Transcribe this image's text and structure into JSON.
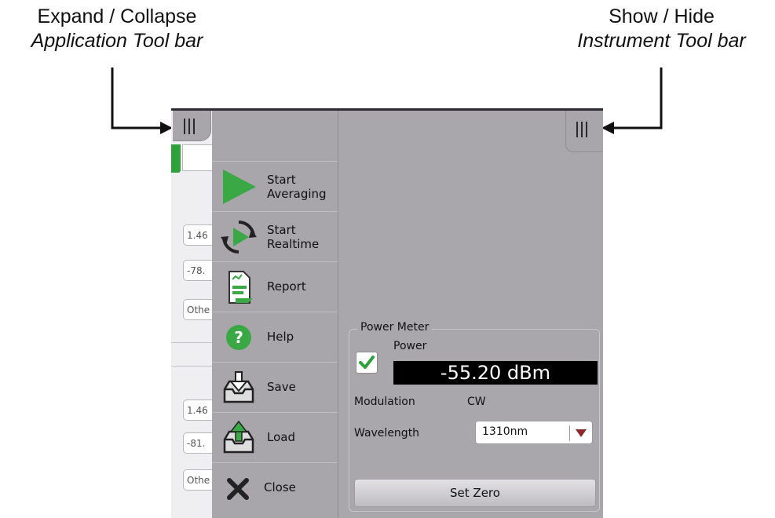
{
  "callouts": {
    "left": {
      "line1": "Expand / Collapse",
      "line2": "Application Tool bar"
    },
    "right": {
      "line1": "Show / Hide",
      "line2": "Instrument Tool bar"
    }
  },
  "background_fields": [
    "1.46",
    "-78.",
    "Othe",
    "1.46",
    "-81.",
    "Othe"
  ],
  "app_toolbar": {
    "items": [
      {
        "line1": "Start",
        "line2": "Averaging",
        "icon": "play-icon"
      },
      {
        "line1": "Start",
        "line2": "Realtime",
        "icon": "refresh-play-icon"
      },
      {
        "line1": "Report",
        "line2": "",
        "icon": "report-icon"
      },
      {
        "line1": "Help",
        "line2": "",
        "icon": "help-icon"
      },
      {
        "line1": "Save",
        "line2": "",
        "icon": "save-icon"
      },
      {
        "line1": "Load",
        "line2": "",
        "icon": "load-icon"
      },
      {
        "line1": "Close",
        "line2": "",
        "icon": "close-icon"
      }
    ]
  },
  "power_meter": {
    "title": "Power Meter",
    "power_label": "Power",
    "power_enabled": true,
    "power_value": "-55.20 dBm",
    "modulation_label": "Modulation",
    "modulation_value": "CW",
    "wavelength_label": "Wavelength",
    "wavelength_value": "1310nm",
    "set_zero_label": "Set Zero"
  },
  "colors": {
    "panel_bg": "#a9a6ac",
    "accent_green": "#2ea13c",
    "value_bg": "#000000"
  }
}
